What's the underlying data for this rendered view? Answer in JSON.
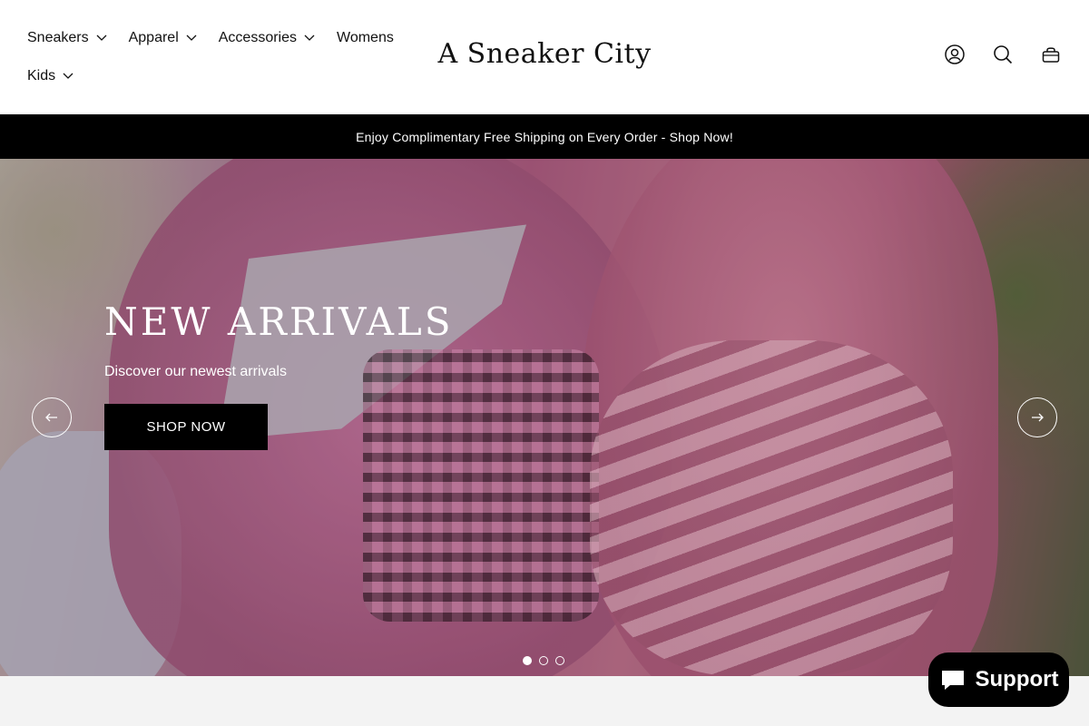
{
  "header": {
    "logo": "A Sneaker City",
    "nav": [
      {
        "label": "Sneakers",
        "has_dropdown": true
      },
      {
        "label": "Apparel",
        "has_dropdown": true
      },
      {
        "label": "Accessories",
        "has_dropdown": true
      },
      {
        "label": "Womens",
        "has_dropdown": false
      },
      {
        "label": "Kids",
        "has_dropdown": true
      }
    ],
    "icons": [
      "account-icon",
      "search-icon",
      "cart-icon"
    ]
  },
  "announcement": {
    "text": "Enjoy Complimentary Free Shipping on Every Order - Shop Now!"
  },
  "hero": {
    "title": "NEW ARRIVALS",
    "subtitle": "Discover our newest arrivals",
    "button_label": "SHOP NOW",
    "slide_count": 3,
    "active_slide": 1
  },
  "support": {
    "label": "Support"
  },
  "colors": {
    "announcement_bg": "#000000",
    "button_bg": "#000000",
    "text": "#111111"
  }
}
